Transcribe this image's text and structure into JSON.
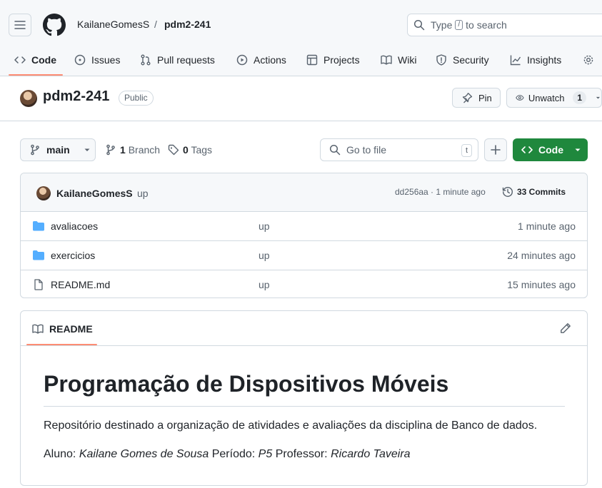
{
  "header": {
    "owner": "KailaneGomesS",
    "separator": "/",
    "repo": "pdm2-241",
    "search_prefix": "Type",
    "search_key": "/",
    "search_suffix": "to search"
  },
  "tabs": [
    {
      "label": "Code",
      "icon": "code-icon",
      "active": true
    },
    {
      "label": "Issues",
      "icon": "issue-icon"
    },
    {
      "label": "Pull requests",
      "icon": "pull-request-icon"
    },
    {
      "label": "Actions",
      "icon": "play-icon"
    },
    {
      "label": "Projects",
      "icon": "table-icon"
    },
    {
      "label": "Wiki",
      "icon": "book-icon"
    },
    {
      "label": "Security",
      "icon": "shield-icon"
    },
    {
      "label": "Insights",
      "icon": "graph-icon"
    }
  ],
  "repo": {
    "title": "pdm2-241",
    "visibility": "Public",
    "pin_label": "Pin",
    "watch_label": "Unwatch",
    "watch_count": "1"
  },
  "toolbar": {
    "branch": "main",
    "branch_count": "1",
    "branch_label": "Branch",
    "tag_count": "0",
    "tag_label": "Tags",
    "goto_placeholder": "Go to file",
    "goto_key": "t",
    "code_label": "Code"
  },
  "commit": {
    "author": "KailaneGomesS",
    "message": "up",
    "hash_time": "dd256aa · 1 minute ago",
    "commits": "33 Commits"
  },
  "files": [
    {
      "name": "avaliacoes",
      "type": "folder",
      "message": "up",
      "age": "1 minute ago"
    },
    {
      "name": "exercicios",
      "type": "folder",
      "message": "up",
      "age": "24 minutes ago"
    },
    {
      "name": "README.md",
      "type": "file",
      "message": "up",
      "age": "15 minutes ago"
    }
  ],
  "readme": {
    "tab_label": "README",
    "heading": "Programação de Dispositivos Móveis",
    "paragraph": "Repositório destinado a organização de atividades e avaliações da disciplina de Banco de dados.",
    "aluno_label": "Aluno:",
    "aluno_value": "Kailane Gomes de Sousa",
    "periodo_label": "Período:",
    "periodo_value": "P5",
    "professor_label": "Professor:",
    "professor_value": "Ricardo Taveira"
  },
  "colors": {
    "accent": "#fd8c73",
    "primary_button": "#1f883d",
    "folder": "#54aeff"
  }
}
